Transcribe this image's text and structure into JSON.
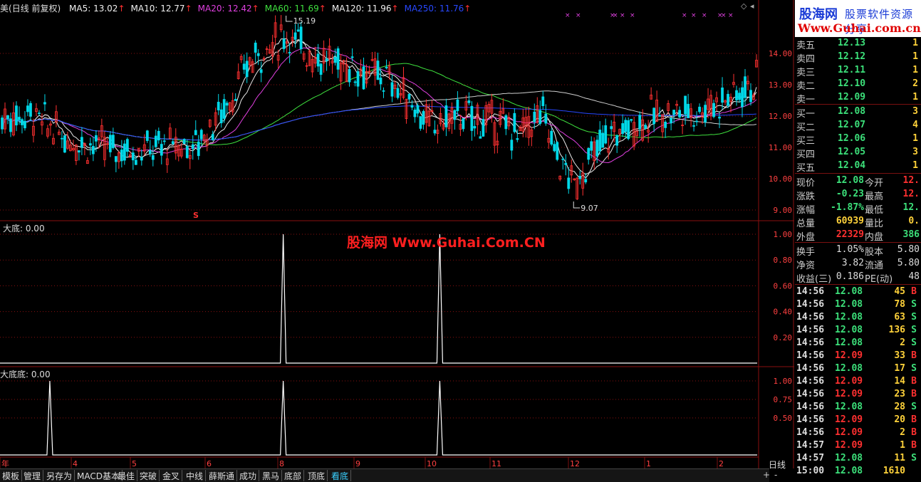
{
  "top_bar": {
    "prefix": "美",
    "title": "(日线 前复权)",
    "ma": [
      {
        "label": "MA5: 13.02",
        "color": "#f0f0f0"
      },
      {
        "label": "MA10: 12.77",
        "color": "#f0f0f0"
      },
      {
        "label": "MA20: 12.42",
        "color": "#e040e0"
      },
      {
        "label": "MA60: 11.69",
        "color": "#3ee03e"
      },
      {
        "label": "MA120: 11.96",
        "color": "#f0f0f0"
      },
      {
        "label": "MA250: 11.76",
        "color": "#2848ff"
      }
    ]
  },
  "colors": {
    "up": "#ff3030",
    "down": "#00d8e8",
    "ma20": "#e040e0",
    "ma60": "#3ee03e",
    "ma250": "#2848ff",
    "grid": "#8a1010"
  },
  "price_axis": [
    {
      "label": "14.00",
      "v": 14
    },
    {
      "label": "13.00",
      "v": 13
    },
    {
      "label": "12.00",
      "v": 12
    },
    {
      "label": "11.00",
      "v": 11
    },
    {
      "label": "10.00",
      "v": 10
    },
    {
      "label": "9.00",
      "v": 9
    }
  ],
  "annotations": {
    "high": "15.19",
    "low": "9.07",
    "marker_s": "S"
  },
  "panel1": {
    "title": "大底: 0.00",
    "axis": [
      "1.00",
      "0.80",
      "0.60",
      "0.40",
      "0.20"
    ]
  },
  "panel2": {
    "title": "大底底: 0.00",
    "axis": [
      "1.00",
      "0.75",
      "0.50"
    ]
  },
  "x_axis": [
    "年",
    "4",
    "5",
    "6",
    "8",
    "9",
    "10",
    "11",
    "12",
    "1",
    "2"
  ],
  "watermark": "股海网 Www.Guhai.Com.CN",
  "logo": {
    "line1": "股海网",
    "line1b": "股票软件资源分享",
    "line2": "Www.Guhai.com.cn"
  },
  "order_book": {
    "sells": [
      {
        "label": "卖五",
        "price": "12.13",
        "vol": "1"
      },
      {
        "label": "卖四",
        "price": "12.12",
        "vol": "1"
      },
      {
        "label": "卖三",
        "price": "12.11",
        "vol": "1"
      },
      {
        "label": "卖二",
        "price": "12.10",
        "vol": "2"
      },
      {
        "label": "卖一",
        "price": "12.09",
        "vol": "1"
      }
    ],
    "buys": [
      {
        "label": "买一",
        "price": "12.08",
        "vol": "3"
      },
      {
        "label": "买二",
        "price": "12.07",
        "vol": "4"
      },
      {
        "label": "买三",
        "price": "12.06",
        "vol": "1"
      },
      {
        "label": "买四",
        "price": "12.05",
        "vol": "3"
      },
      {
        "label": "买五",
        "price": "12.04",
        "vol": "1"
      }
    ]
  },
  "quote": [
    {
      "l1": "现价",
      "v1": "12.08",
      "c1": "#3ce07a",
      "l2": "今开",
      "v2": "12.",
      "c2": "#ff3030"
    },
    {
      "l1": "涨跌",
      "v1": "-0.23",
      "c1": "#3ce07a",
      "l2": "最高",
      "v2": "12.",
      "c2": "#ff3030"
    },
    {
      "l1": "涨幅",
      "v1": "-1.87%",
      "c1": "#3ce07a",
      "l2": "最低",
      "v2": "12.",
      "c2": "#3ce07a"
    },
    {
      "l1": "总量",
      "v1": "60939",
      "c1": "#ffd23a",
      "l2": "量比",
      "v2": "0.",
      "c2": "#ffd23a"
    },
    {
      "l1": "外盘",
      "v1": "22329",
      "c1": "#ff3030",
      "l2": "内盘",
      "v2": "386",
      "c2": "#3ce07a"
    }
  ],
  "quote2": [
    {
      "l1": "换手",
      "v1": "1.05%",
      "l2": "股本",
      "v2": "5.80"
    },
    {
      "l1": "净资",
      "v1": "3.82",
      "l2": "流通",
      "v2": "5.80"
    },
    {
      "l1": "收益(三)",
      "v1": "0.186",
      "l2": "PE(动)",
      "v2": "48"
    }
  ],
  "ticks": [
    {
      "t": "14:56",
      "p": "12.08",
      "v": "45",
      "s": "B"
    },
    {
      "t": "14:56",
      "p": "12.08",
      "v": "78",
      "s": "S"
    },
    {
      "t": "14:56",
      "p": "12.08",
      "v": "63",
      "s": "S"
    },
    {
      "t": "14:56",
      "p": "12.08",
      "v": "136",
      "s": "S"
    },
    {
      "t": "14:56",
      "p": "12.08",
      "v": "2",
      "s": "S"
    },
    {
      "t": "14:56",
      "p": "12.09",
      "v": "33",
      "s": "B"
    },
    {
      "t": "14:56",
      "p": "12.08",
      "v": "17",
      "s": "S"
    },
    {
      "t": "14:56",
      "p": "12.09",
      "v": "14",
      "s": "B"
    },
    {
      "t": "14:56",
      "p": "12.09",
      "v": "23",
      "s": "B"
    },
    {
      "t": "14:56",
      "p": "12.08",
      "v": "28",
      "s": "S"
    },
    {
      "t": "14:56",
      "p": "12.09",
      "v": "20",
      "s": "B"
    },
    {
      "t": "14:56",
      "p": "12.09",
      "v": "2",
      "s": "B"
    },
    {
      "t": "14:57",
      "p": "12.09",
      "v": "1",
      "s": "B"
    },
    {
      "t": "14:57",
      "p": "12.08",
      "v": "11",
      "s": "S"
    },
    {
      "t": "15:00",
      "p": "12.08",
      "v": "1610",
      "s": ""
    }
  ],
  "tabs": [
    "模板",
    "管理",
    "另存为",
    "MACD基本",
    "最佳",
    "突破",
    "金叉",
    "中线",
    "薛斯通",
    "成功",
    "黑马",
    "底部",
    "顶底",
    "看底"
  ],
  "active_tab": "看底",
  "period_label": "日线",
  "controls": {
    "plus": "+",
    "minus": "-"
  },
  "signal_days": {
    "panel1": [
      99,
      154
    ],
    "panel2": [
      17,
      99,
      154
    ]
  }
}
